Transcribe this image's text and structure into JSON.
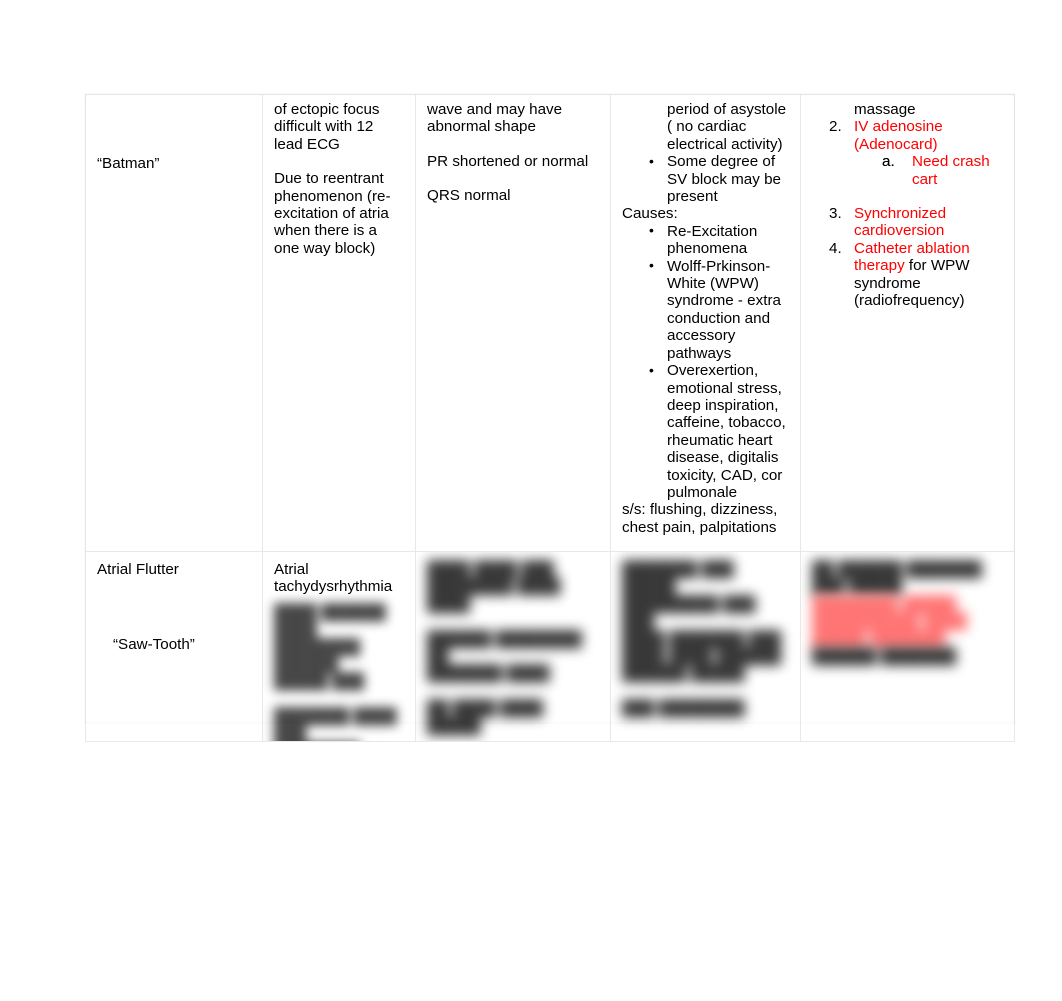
{
  "document": {
    "type": "reference-table",
    "title_visible": false
  },
  "table": {
    "columns": 5,
    "rows": [
      {
        "id": "paroxysmal-svt",
        "clipped_top": true,
        "col1": {
          "nickname": "“Batman”"
        },
        "col2": {
          "paragraphs": [
            "of ectopic focus difficult with 12 lead ECG",
            "Due to reentrant phenomenon (re-excitation of atria when there is a one way block)"
          ]
        },
        "col3": {
          "paragraphs": [
            "wave and may have abnormal shape",
            "PR shortened or normal",
            "QRS normal"
          ]
        },
        "col4": {
          "continuation": "period of asystole ( no cardiac electrical activity)",
          "bullets_before": [
            "Some degree of SV block may be present"
          ],
          "causes_label": "Causes:",
          "causes": [
            "Re-Excitation phenomena",
            "Wolff-Prkinson-White (WPW) syndrome - extra conduction and accessory pathways",
            "Overexertion, emotional stress, deep inspiration, caffeine, tobacco, rheumatic heart disease, digitalis toxicity, CAD, cor pulmonale"
          ],
          "signs_symptoms": "s/s: flushing, dizziness, chest pain, palpitations"
        },
        "col5": {
          "continuation": "massage",
          "items": [
            {
              "number": "2.",
              "parts": [
                {
                  "text": "IV adenosine (Adenocard)",
                  "color": "#ff0000"
                }
              ],
              "sub": [
                {
                  "marker": "a.",
                  "text": "Need crash cart",
                  "color": "#ff0000"
                }
              ]
            },
            {
              "number": "3.",
              "parts": [
                {
                  "text": "Synchronized cardioversion",
                  "color": "#ff0000"
                }
              ],
              "sub": []
            },
            {
              "number": "4.",
              "parts": [
                {
                  "text": "Catheter ablation therapy ",
                  "color": "#ff0000"
                },
                {
                  "text": "for WPW syndrome (radiofrequency)",
                  "color": "#000000"
                }
              ],
              "sub": []
            }
          ]
        }
      },
      {
        "id": "atrial-flutter",
        "blurred": true,
        "col1": {
          "name": "Atrial Flutter",
          "nickname": "“Saw-Tooth”"
        },
        "col2": {
          "heading": "Atrial tachydysrhythmia",
          "blurred_text": "████ ██████ ████\n████████ ██████\n█████ ███\n\n███████ ████ ███\n████████ ██████"
        },
        "col3": {
          "blurred_text": "████ ████ ███\n████████ ████\n████\n\n██████ ████████ ██\n███████ ████\n\n██ ████ ████ █████"
        },
        "col4": {
          "blurred_text": "███████ ███ █████\n█████████ ███ ███\n████ ███████ ███\n████ ████ ██████\n██████ █████\n\n███ ████████"
        },
        "col5": {
          "blurred_text": "██ ██████ ███████\n███ █████",
          "blurred_red_text": "████████ █████\n██████████ ████\n█████ ███████",
          "blurred_tail_text": "██████ ███████"
        }
      }
    ]
  },
  "colors": {
    "accent_red": "#ff0000",
    "text": "#000000",
    "border": "#e8e8e8",
    "page_background": "#ffffff"
  }
}
